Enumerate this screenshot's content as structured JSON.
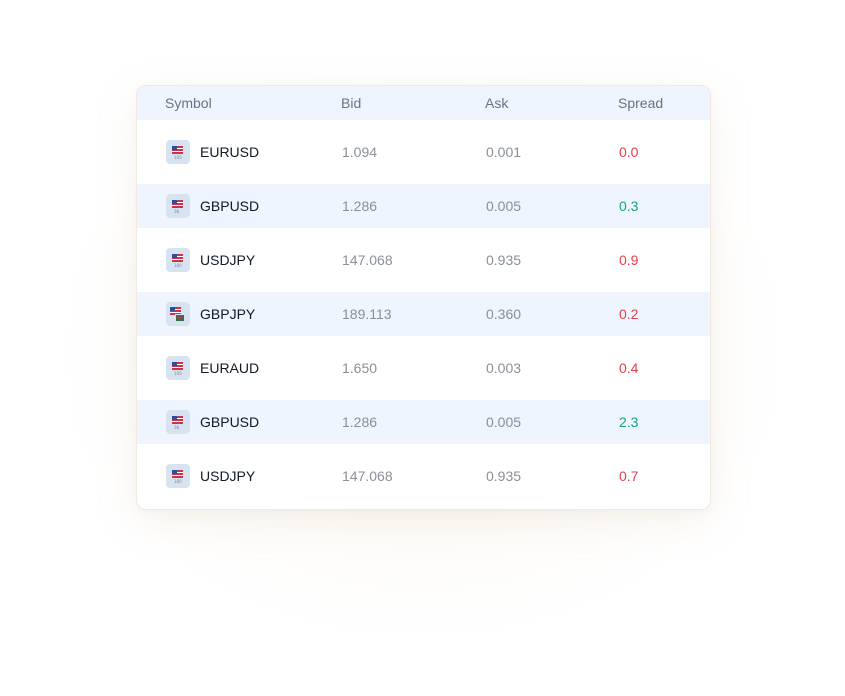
{
  "table": {
    "headers": {
      "symbol": "Symbol",
      "bid": "Bid",
      "ask": "Ask",
      "spread": "Spread"
    },
    "rows": [
      {
        "symbol": "EURUSD",
        "bid": "1.094",
        "ask": "0.001",
        "spread": "0.0",
        "spread_color": "#e53e4d",
        "icon": "us-flag-icon"
      },
      {
        "symbol": "GBPUSD",
        "bid": "1.286",
        "ask": "0.005",
        "spread": "0.3",
        "spread_color": "#12a37a",
        "icon": "us-flag-icon"
      },
      {
        "symbol": "USDJPY",
        "bid": "147.068",
        "ask": "0.935",
        "spread": "0.9",
        "spread_color": "#e53e4d",
        "icon": "us-flag-icon"
      },
      {
        "symbol": "GBPJPY",
        "bid": "189.113",
        "ask": "0.360",
        "spread": "0.2",
        "spread_color": "#e53e4d",
        "icon": "dual-flag-icon"
      },
      {
        "symbol": "EURAUD",
        "bid": "1.650",
        "ask": "0.003",
        "spread": "0.4",
        "spread_color": "#e53e4d",
        "icon": "us-flag-icon"
      },
      {
        "symbol": "GBPUSD",
        "bid": "1.286",
        "ask": "0.005",
        "spread": "2.3",
        "spread_color": "#12a37a",
        "icon": "us-flag-icon"
      },
      {
        "symbol": "USDJPY",
        "bid": "147.068",
        "ask": "0.935",
        "spread": "0.7",
        "spread_color": "#e53e4d",
        "icon": "us-flag-icon"
      }
    ]
  },
  "colors": {
    "header_bg": "#eef5fe",
    "row_alt_bg": "#eef5fe",
    "positive": "#12a37a",
    "negative": "#e53e4d"
  }
}
